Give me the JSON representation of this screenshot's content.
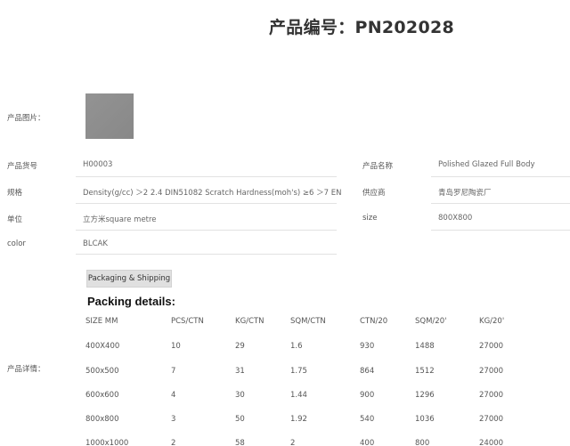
{
  "page_title": "产品编号：PN202028",
  "labels": {
    "image": "产品图片：",
    "item_no": "产品货号",
    "spec": "规格",
    "unit": "单位",
    "color": "color",
    "name": "产品名称",
    "supplier": "供应商",
    "size": "size",
    "details": "产品详情："
  },
  "values": {
    "item_no": "H00003",
    "spec": "Density(g/cc)   ＞2   2.4   DIN51082 Scratch Hardness(moh's)     ≥6   ＞7   EN",
    "unit": "立方米square metre",
    "color": "BLCAK",
    "name": "Polished Glazed Full Body",
    "supplier": "青岛罗尼陶瓷厂",
    "size": "800X800"
  },
  "packaging_button": "Packaging & Shipping",
  "packing_title": "Packing details:",
  "table": {
    "headers": [
      "SIZE MM",
      "PCS/CTN",
      "KG/CTN",
      "SQM/CTN",
      "CTN/20",
      "SQM/20'",
      "KG/20'"
    ],
    "rows": [
      [
        "400X400",
        "10",
        "29",
        "1.6",
        "930",
        "1488",
        "27000"
      ],
      [
        "500x500",
        "7",
        "31",
        "1.75",
        "864",
        "1512",
        "27000"
      ],
      [
        "600x600",
        "4",
        "30",
        "1.44",
        "900",
        "1296",
        "27000"
      ],
      [
        "800x800",
        "3",
        "50",
        "1.92",
        "540",
        "1036",
        "27000"
      ],
      [
        "1000x1000",
        "2",
        "58",
        "2",
        "400",
        "800",
        "24000"
      ]
    ]
  }
}
